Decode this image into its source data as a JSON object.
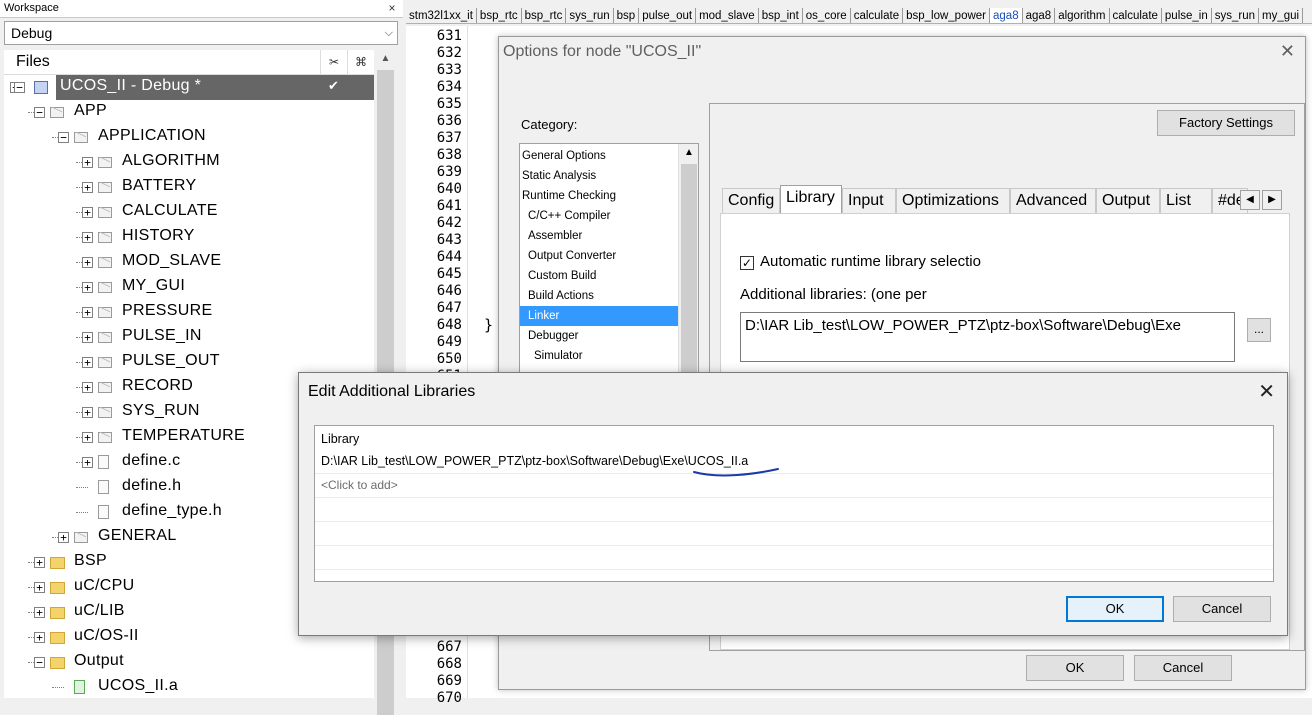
{
  "workspace": {
    "title": "Workspace",
    "close_glyph": "×",
    "configuration": "Debug",
    "files_title": "Files",
    "col1_glyph": "✂",
    "col2_glyph": "⌘",
    "project_check": "✔",
    "tree": [
      {
        "label": "UCOS_II - Debug *",
        "level": 0,
        "expand": "−",
        "icon": "project"
      },
      {
        "label": "APP",
        "level": 1,
        "expand": "−",
        "icon": "folder-gray"
      },
      {
        "label": "APPLICATION",
        "level": 2,
        "expand": "−",
        "icon": "folder-gray"
      },
      {
        "label": "ALGORITHM",
        "level": 3,
        "expand": "+",
        "icon": "folder-gray"
      },
      {
        "label": "BATTERY",
        "level": 3,
        "expand": "+",
        "icon": "folder-gray"
      },
      {
        "label": "CALCULATE",
        "level": 3,
        "expand": "+",
        "icon": "folder-gray"
      },
      {
        "label": "HISTORY",
        "level": 3,
        "expand": "+",
        "icon": "folder-gray"
      },
      {
        "label": "MOD_SLAVE",
        "level": 3,
        "expand": "+",
        "icon": "folder-gray"
      },
      {
        "label": "MY_GUI",
        "level": 3,
        "expand": "+",
        "icon": "folder-gray"
      },
      {
        "label": "PRESSURE",
        "level": 3,
        "expand": "+",
        "icon": "folder-gray"
      },
      {
        "label": "PULSE_IN",
        "level": 3,
        "expand": "+",
        "icon": "folder-gray"
      },
      {
        "label": "PULSE_OUT",
        "level": 3,
        "expand": "+",
        "icon": "folder-gray"
      },
      {
        "label": "RECORD",
        "level": 3,
        "expand": "+",
        "icon": "folder-gray"
      },
      {
        "label": "SYS_RUN",
        "level": 3,
        "expand": "+",
        "icon": "folder-gray"
      },
      {
        "label": "TEMPERATURE",
        "level": 3,
        "expand": "+",
        "icon": "folder-gray"
      },
      {
        "label": "define.c",
        "level": 3,
        "expand": "+",
        "icon": "file"
      },
      {
        "label": "define.h",
        "level": 3,
        "expand": "",
        "icon": "file"
      },
      {
        "label": "define_type.h",
        "level": 3,
        "expand": "",
        "icon": "file"
      },
      {
        "label": "GENERAL",
        "level": 2,
        "expand": "+",
        "icon": "folder-gray"
      },
      {
        "label": "BSP",
        "level": 1,
        "expand": "+",
        "icon": "folder-yellow"
      },
      {
        "label": "uC/CPU",
        "level": 1,
        "expand": "+",
        "icon": "folder-yellow"
      },
      {
        "label": "uC/LIB",
        "level": 1,
        "expand": "+",
        "icon": "folder-yellow"
      },
      {
        "label": "uC/OS-II",
        "level": 1,
        "expand": "+",
        "icon": "folder-yellow"
      },
      {
        "label": "Output",
        "level": 1,
        "expand": "−",
        "icon": "folder-yellow"
      },
      {
        "label": "UCOS_II.a",
        "level": 2,
        "expand": "",
        "icon": "file-green"
      }
    ]
  },
  "editor_tabs": [
    "stm32l1xx_it",
    "bsp_rtc",
    "bsp_rtc",
    "sys_run",
    "bsp",
    "pulse_out",
    "mod_slave",
    "bsp_int",
    "os_core",
    "calculate",
    "bsp_low_power",
    "aga8",
    "aga8",
    "algorithm",
    "calculate",
    "pulse_in",
    "sys_run",
    "my_gui"
  ],
  "editor_active_tab": 11,
  "editor": {
    "line_numbers": [
      "631",
      "632",
      "633",
      "634",
      "635",
      "636",
      "637",
      "638",
      "639",
      "640",
      "641",
      "642",
      "643",
      "644",
      "645",
      "646",
      "647",
      "648",
      "649",
      "650",
      "651"
    ],
    "line_numbers_bottom": [
      "667",
      "668",
      "669",
      "670"
    ],
    "code_brace": "}"
  },
  "options_dialog": {
    "title": "Options for node \"UCOS_II\"",
    "close_glyph": "✕",
    "category_label": "Category:",
    "categories": [
      {
        "label": "General Options",
        "indent": 0
      },
      {
        "label": "Static Analysis",
        "indent": 0
      },
      {
        "label": "Runtime Checking",
        "indent": 0
      },
      {
        "label": "C/C++ Compiler",
        "indent": 1
      },
      {
        "label": "Assembler",
        "indent": 1
      },
      {
        "label": "Output Converter",
        "indent": 1
      },
      {
        "label": "Custom Build",
        "indent": 1
      },
      {
        "label": "Build Actions",
        "indent": 1
      },
      {
        "label": "Linker",
        "indent": 1
      },
      {
        "label": "Debugger",
        "indent": 1
      },
      {
        "label": "Simulator",
        "indent": 2
      }
    ],
    "selected_category": 8,
    "factory_settings": "Factory Settings",
    "tabs": [
      "Config",
      "Library",
      "Input",
      "Optimizations",
      "Advanced",
      "Output",
      "List",
      "#de"
    ],
    "active_tab": 1,
    "tab_prev": "◀",
    "tab_next": "▶",
    "auto_runtime_label": "Automatic runtime library selectio",
    "auto_runtime_checked": "✓",
    "additional_libraries_label": "Additional libraries: (one per",
    "additional_libraries_value": "D:\\IAR Lib_test\\LOW_POWER_PTZ\\ptz-box\\Software\\Debug\\Exe",
    "browse_label": "...",
    "ok": "OK",
    "cancel": "Cancel"
  },
  "edit_libraries_dialog": {
    "title": "Edit Additional Libraries",
    "close_glyph": "✕",
    "column_header": "Library",
    "entries": [
      "D:\\IAR Lib_test\\LOW_POWER_PTZ\\ptz-box\\Software\\Debug\\Exe\\UCOS_II.a"
    ],
    "click_to_add": "<Click to add>",
    "ok": "OK",
    "cancel": "Cancel"
  },
  "colors": {
    "selection": "#3399ff",
    "project_row": "#666666",
    "annotation": "#1a3aa8",
    "focus_border": "#0078d7"
  }
}
